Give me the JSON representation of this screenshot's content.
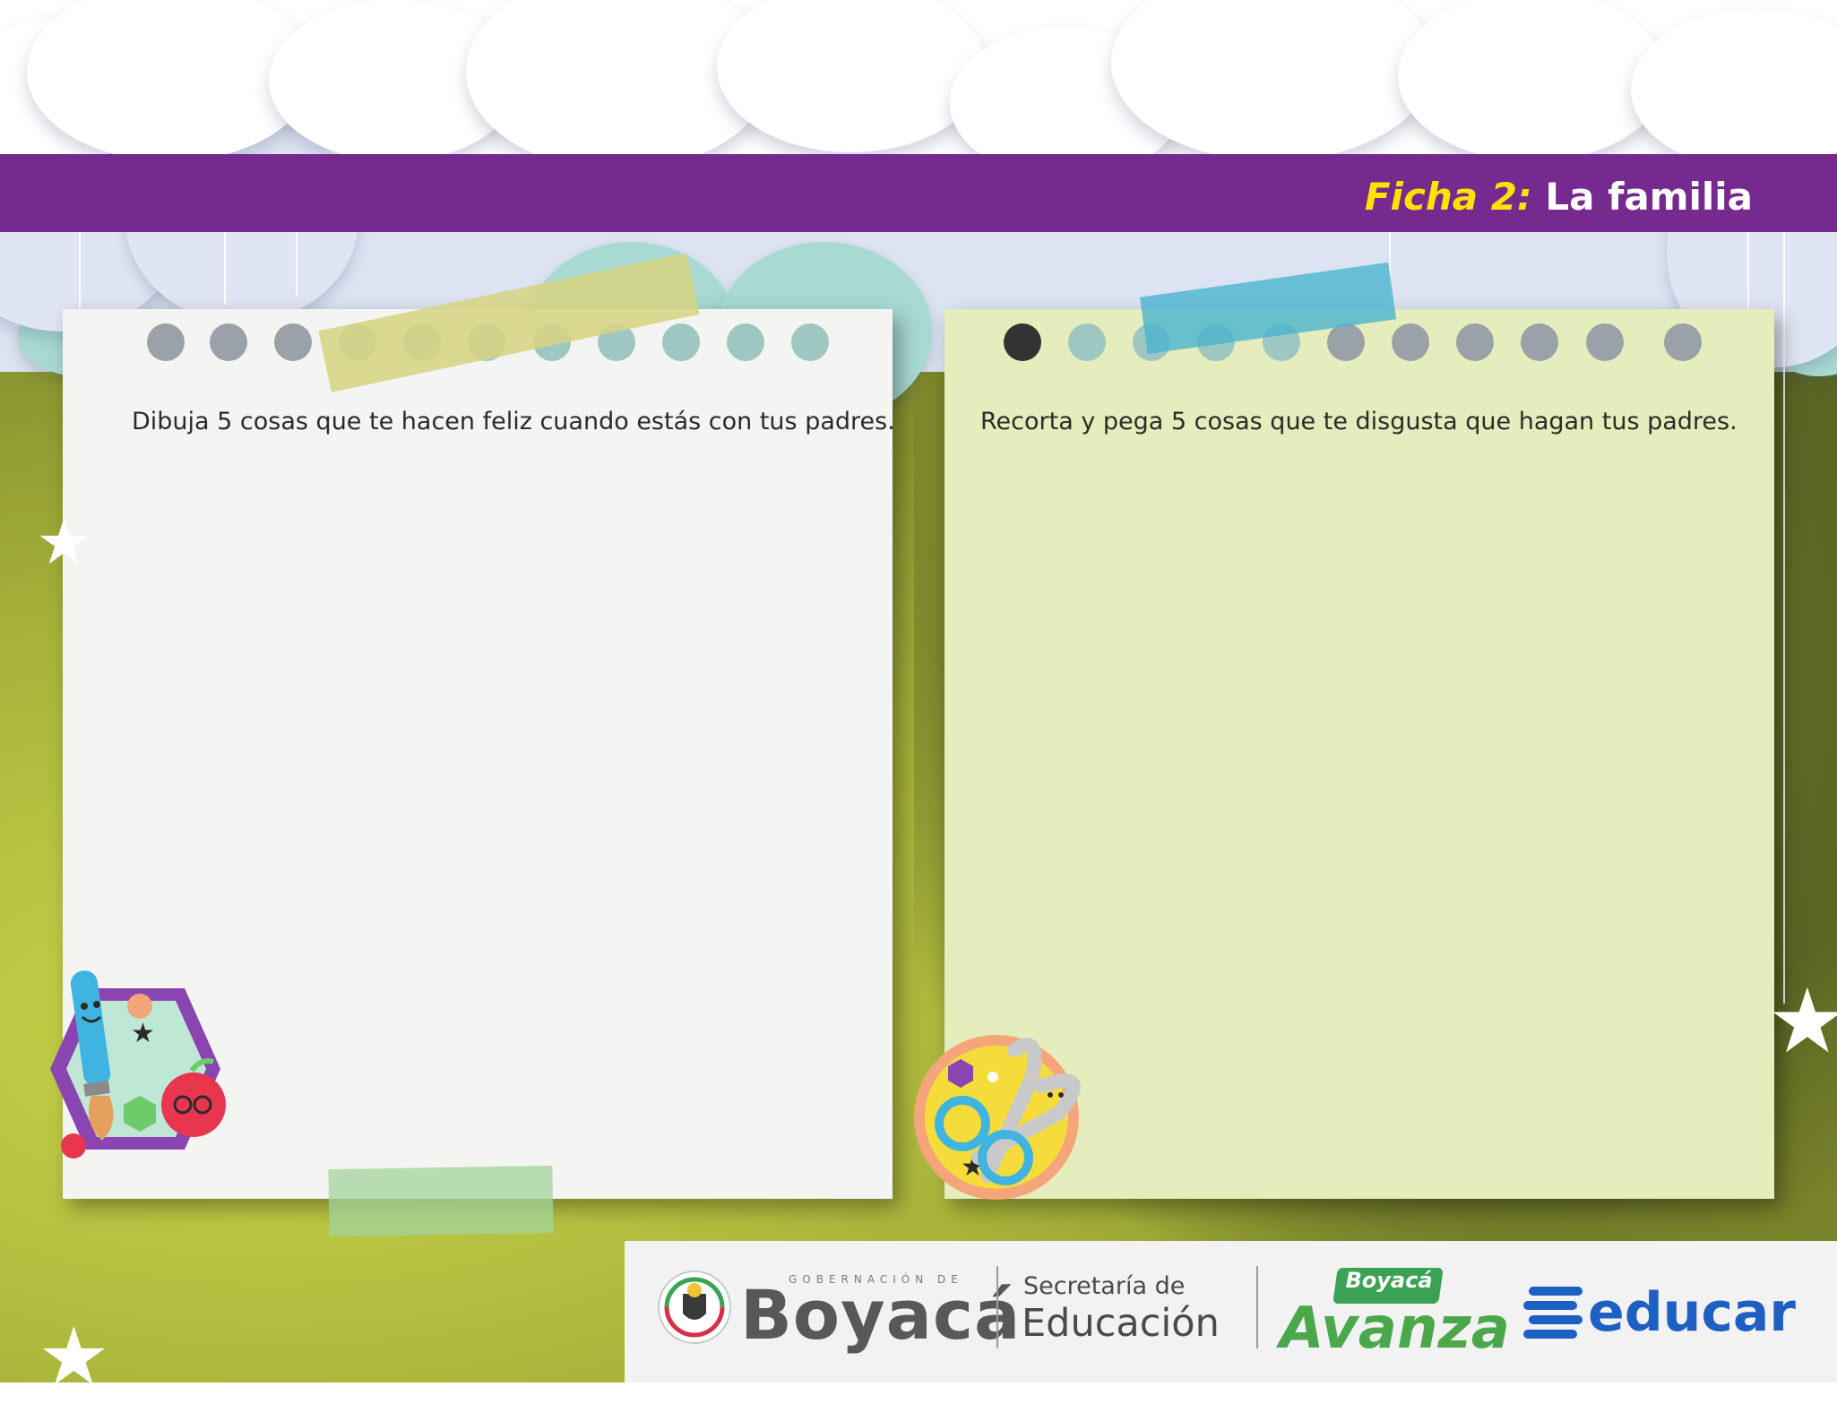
{
  "header": {
    "ficha_label": "Ficha 2:",
    "title": "La familia",
    "colors": {
      "banner": "#762a90",
      "ficha": "#ffe200",
      "title": "#ffffff"
    }
  },
  "pages": {
    "left": {
      "instruction": "Dibuja 5 cosas que te hacen feliz cuando estás con tus padres.",
      "color": "#f4f4f2"
    },
    "right": {
      "instruction": "Recorta y pega 5 cosas que te disgusta que hagan tus padres.",
      "color": "#e4edbb"
    }
  },
  "stickers": {
    "left": "paintbrush-and-apple-sticker",
    "right": "scissors-sticker"
  },
  "footer": {
    "gobernacion_label": "GOBERNACIÓN DE",
    "boyaca": "Boyacá",
    "secretaria_line1": "Secretaría de",
    "secretaria_line2": "Educación",
    "avanza_top": "Boyacá",
    "avanza": "Avanza",
    "educar": "educar"
  }
}
